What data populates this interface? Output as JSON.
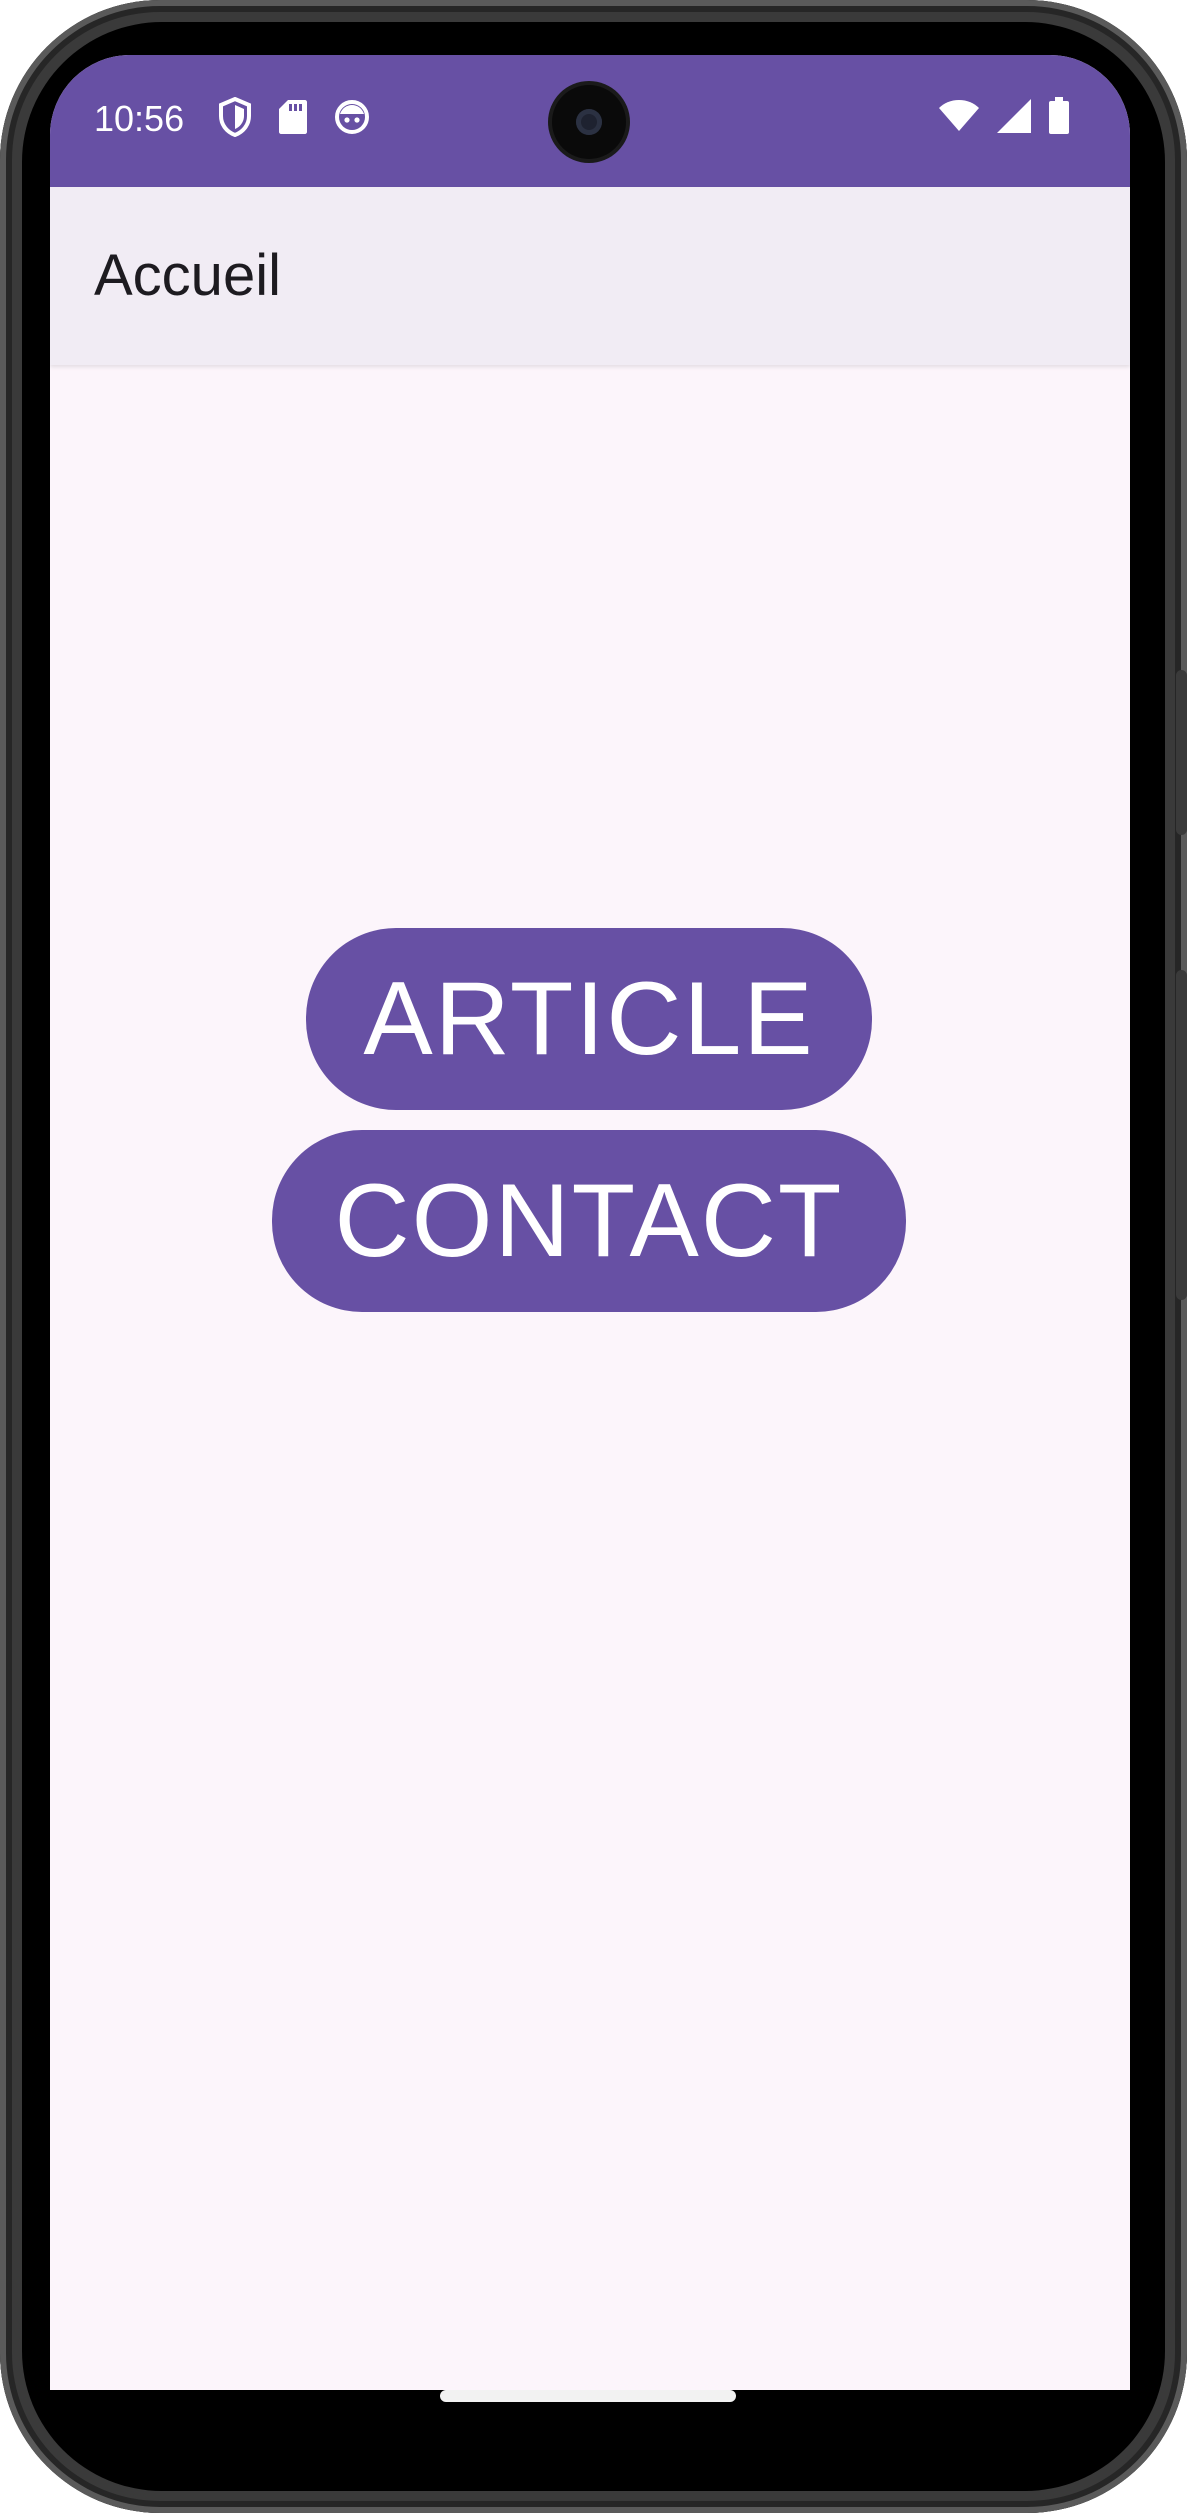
{
  "status_bar": {
    "time": "10:56",
    "left_icons": [
      "shield-icon",
      "sd-card-icon",
      "android-face-icon"
    ],
    "right_icons": [
      "wifi-icon",
      "signal-icon",
      "battery-icon"
    ],
    "background": "#6750a4"
  },
  "app_bar": {
    "title": "Accueil"
  },
  "buttons": {
    "article_label": "ARTICLE",
    "contact_label": "CONTACT"
  },
  "colors": {
    "primary": "#6750a4",
    "surface": "#fcf5fb",
    "app_bar": "#f1ecf4"
  }
}
